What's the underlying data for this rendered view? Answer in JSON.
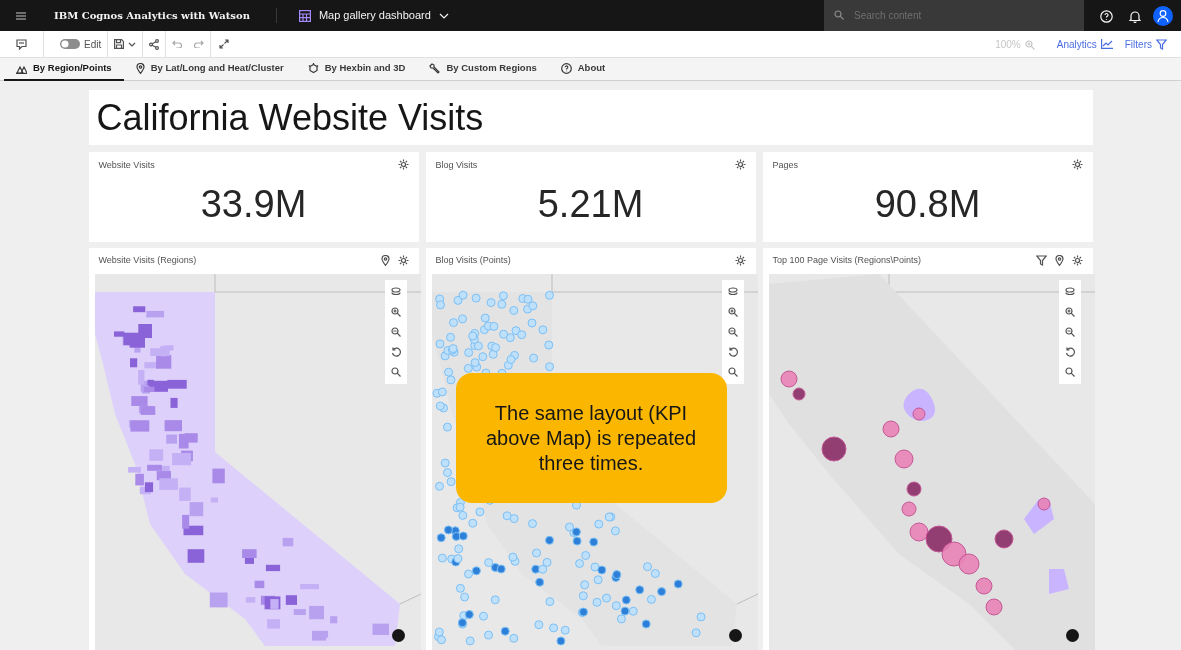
{
  "header": {
    "product": "IBM Cognos Analytics with Watson",
    "dashboard": "Map gallery dashboard",
    "search": {
      "placeholder": "Search content"
    }
  },
  "toolbar": {
    "edit": {
      "label": "Edit",
      "on": false
    },
    "zoom": "100%",
    "analytics": "Analytics",
    "filters": "Filters"
  },
  "tabs": [
    {
      "label": "By Region/Points",
      "selected": true
    },
    {
      "label": "By Lat/Long and Heat/Cluster",
      "selected": false
    },
    {
      "label": "By Hexbin and 3D",
      "selected": false
    },
    {
      "label": "By Custom Regions",
      "selected": false
    },
    {
      "label": "About",
      "selected": false
    }
  ],
  "title": "California Website Visits",
  "kpis": [
    {
      "title": "Website Visits",
      "value": "33.9M"
    },
    {
      "title": "Blog Visits",
      "value": "5.21M"
    },
    {
      "title": "Pages",
      "value": "90.8M"
    }
  ],
  "maps": [
    {
      "title": "Website Visits (Regions)",
      "kind": "regions"
    },
    {
      "title": "Blog Visits (Points)",
      "kind": "points"
    },
    {
      "title": "Top 100  Page Visits (Regions\\Points)",
      "kind": "combined"
    }
  ],
  "callout": {
    "text": "The same layout (KPI above Map) is repeated three times."
  }
}
